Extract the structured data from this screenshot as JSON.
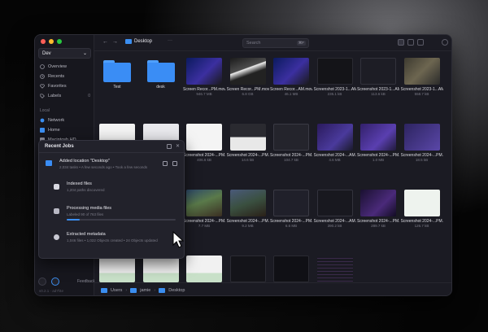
{
  "sidebar": {
    "space": "Dev",
    "items": [
      {
        "label": "Overview",
        "icon": "overview-icon"
      },
      {
        "label": "Recents",
        "icon": "clock-icon"
      },
      {
        "label": "Favorites",
        "icon": "heart-icon"
      },
      {
        "label": "Labels",
        "icon": "tag-icon"
      }
    ],
    "labels_count": "0",
    "local_section": "Local",
    "local_items": [
      {
        "label": "Network",
        "icon": "globe-icon"
      },
      {
        "label": "Home",
        "icon": "home-folder-icon"
      },
      {
        "label": "Macintosh HD",
        "icon": "drive-icon"
      }
    ],
    "feedback": "Feedback",
    "version": "v0.2.1 · ad7f4e"
  },
  "topbar": {
    "title": "Desktop",
    "more": "···",
    "search_placeholder": "Search",
    "search_shortcut": "⌘F"
  },
  "files": [
    {
      "name": "Test",
      "size": "",
      "kind": "folder"
    },
    {
      "name": "desk",
      "size": "",
      "kind": "folder"
    },
    {
      "name": "Screen Recor...PM.mov",
      "size": "946.7 MB",
      "kind": "video-blue"
    },
    {
      "name": "Screen Recor...PM.mov",
      "size": "6.8 GB",
      "kind": "video-dark"
    },
    {
      "name": "Screen Recor...AM.mov",
      "size": "46.1 MB",
      "kind": "video-blue"
    },
    {
      "name": "Screenshot 2023-1...AM.png",
      "size": "235.1 kB",
      "kind": "shot-dark"
    },
    {
      "name": "Screenshot 2023-1...AM.png",
      "size": "113.6 kB",
      "kind": "shot-code"
    },
    {
      "name": "Screenshot 2023-1...AM.png",
      "size": "558.7 kB",
      "kind": "shot-map"
    },
    {
      "name": "",
      "size": "",
      "kind": "shot-doc"
    },
    {
      "name": "",
      "size": "",
      "kind": "shot-doc2"
    },
    {
      "name": "Screenshot 2024-...PM.png",
      "size": "406.6 kB",
      "kind": "shot-white"
    },
    {
      "name": "Screenshot 2024-...PM.png",
      "size": "14.6 kB",
      "kind": "shot-dark2"
    },
    {
      "name": "Screenshot 2024-...PM.png",
      "size": "104.7 kB",
      "kind": "shot-dark3"
    },
    {
      "name": "Screenshot 2024-...AM.png",
      "size": "4.6 MB",
      "kind": "shot-purple"
    },
    {
      "name": "Screenshot 2024-...PM.png",
      "size": "1.0 MB",
      "kind": "shot-purple2"
    },
    {
      "name": "Screenshot 2024-...PM.png",
      "size": "18.5 kB",
      "kind": "shot-purple3"
    },
    {
      "name": "",
      "size": "",
      "kind": "shot-game"
    },
    {
      "name": "",
      "size": "",
      "kind": "shot-game2"
    },
    {
      "name": "Screenshot 2024-...PM.png",
      "size": "7.7 MB",
      "kind": "shot-game"
    },
    {
      "name": "Screenshot 2024-...PM.png",
      "size": "9.2 MB",
      "kind": "shot-game2"
    },
    {
      "name": "Screenshot 2024-...PM.png",
      "size": "6.6 MB",
      "kind": "shot-dark4"
    },
    {
      "name": "Screenshot 2024-...AM.png",
      "size": "390.2 kB",
      "kind": "shot-dark5"
    },
    {
      "name": "Screenshot 2024-...PM.png",
      "size": "289.7 kB",
      "kind": "shot-profile"
    },
    {
      "name": "Screenshot 2024-...PM.png",
      "size": "126.7 kB",
      "kind": "shot-green"
    },
    {
      "name": "",
      "size": "",
      "kind": "shot-doc3"
    },
    {
      "name": "",
      "size": "",
      "kind": "shot-doc3"
    },
    {
      "name": "",
      "size": "",
      "kind": "shot-doc3"
    },
    {
      "name": "",
      "size": "",
      "kind": "shot-dark6"
    },
    {
      "name": "",
      "size": "",
      "kind": "shot-dark7"
    },
    {
      "name": "",
      "size": "",
      "kind": "shot-list"
    }
  ],
  "statusbar": {
    "path": [
      "Users",
      "jamie",
      "Desktop"
    ]
  },
  "jobs": {
    "title": "Recent Jobs",
    "main": {
      "title": "Added location \"Desktop\"",
      "subtitle": "2,034 tasks • A few seconds ago • Took a few seconds"
    },
    "subjobs": [
      {
        "title": "Indexed files",
        "subtitle": "1,204 paths discovered",
        "icon": "folder-icon"
      },
      {
        "title": "Processing media files",
        "subtitle": "Labeled 90 of 763 files",
        "icon": "image-icon",
        "progress": 0.118
      },
      {
        "title": "Extracted metadata",
        "subtitle": "1,046 files • 1,022 Objects created • 24 Objects updated",
        "icon": "metadata-icon"
      }
    ]
  },
  "colors": {
    "accent": "#3b8ef0",
    "window_bg": "#1c1c24",
    "sidebar_bg": "#17171e"
  }
}
